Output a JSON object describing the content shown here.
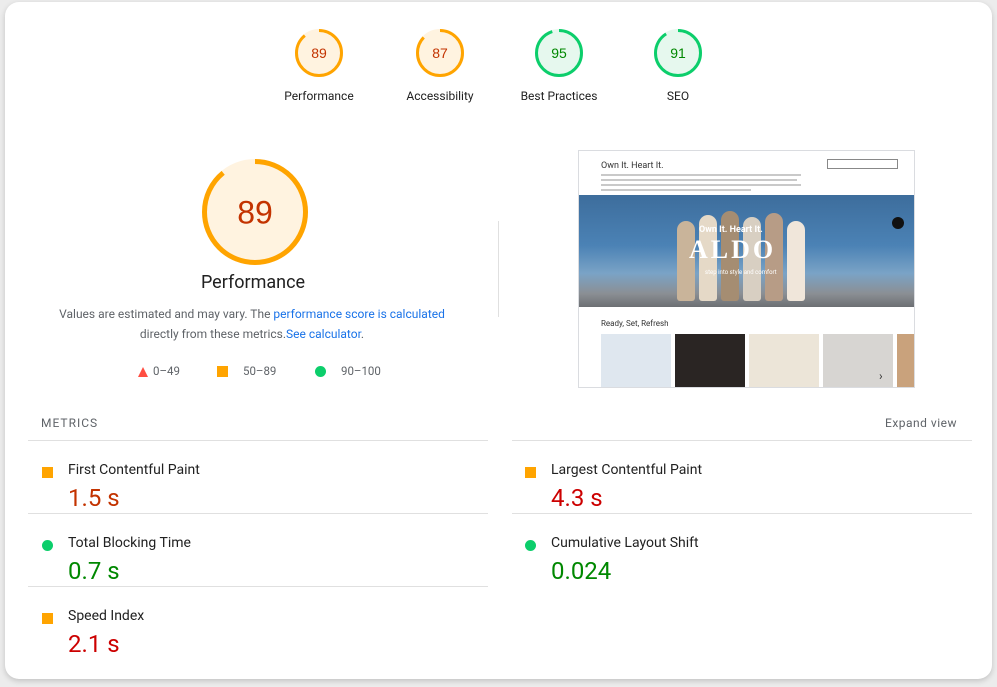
{
  "colors": {
    "average": "#ffa400",
    "average_text": "#c33300",
    "pass": "#0cce6b",
    "pass_text": "#008800",
    "fail_text": "#cc0000",
    "average_bg": "#fff3e0",
    "pass_bg": "#e6f8ee"
  },
  "scores": [
    {
      "label": "Performance",
      "value": "89",
      "score": 89,
      "rating": "average"
    },
    {
      "label": "Accessibility",
      "value": "87",
      "score": 87,
      "rating": "average"
    },
    {
      "label": "Best Practices",
      "value": "95",
      "score": 95,
      "rating": "pass"
    },
    {
      "label": "SEO",
      "value": "91",
      "score": 91,
      "rating": "pass"
    }
  ],
  "performance": {
    "score": 89,
    "score_text": "89",
    "title": "Performance",
    "desc_prefix": "Values are estimated and may vary. The ",
    "desc_link": "performance score is calculated",
    "desc_mid": "directly from these metrics.",
    "desc_link2": "See calculator",
    "desc_end": "."
  },
  "legend": {
    "fail": "0–49",
    "average": "50–89",
    "pass": "90–100"
  },
  "screenshot": {
    "heading": "Own It. Heart It.",
    "hero_tagline": "Own It. Heart It.",
    "hero_logo": "ALDO",
    "hero_sub": "step into style and comfort",
    "section": "Ready, Set, Refresh",
    "next_icon": "chevron-right-icon",
    "chat_icon": "chat-icon"
  },
  "metrics": {
    "header": "METRICS",
    "expand_label": "Expand view",
    "items": [
      {
        "name": "First Contentful Paint",
        "value": "1.5 s",
        "rating": "average"
      },
      {
        "name": "Largest Contentful Paint",
        "value": "4.3 s",
        "rating": "fail"
      },
      {
        "name": "Total Blocking Time",
        "value": "0.7 s",
        "rating": "pass"
      },
      {
        "name": "Cumulative Layout Shift",
        "value": "0.024",
        "rating": "pass"
      },
      {
        "name": "Speed Index",
        "value": "2.1 s",
        "rating": "fail"
      }
    ]
  }
}
